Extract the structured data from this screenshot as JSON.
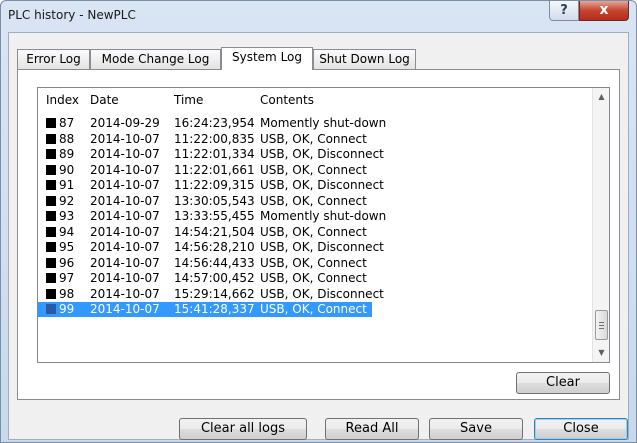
{
  "window": {
    "title": "PLC history - NewPLC",
    "help_label": "?",
    "close_label": "x"
  },
  "tabs": [
    {
      "label": "Error Log"
    },
    {
      "label": "Mode Change Log"
    },
    {
      "label": "System Log",
      "active": true
    },
    {
      "label": "Shut Down Log"
    }
  ],
  "list": {
    "columns": [
      "Index",
      "Date",
      "Time",
      "Contents"
    ],
    "rows": [
      {
        "index": "87",
        "date": "2014-09-29",
        "time": "16:24:23,954",
        "contents": "Momently shut-down"
      },
      {
        "index": "88",
        "date": "2014-10-07",
        "time": "11:22:00,835",
        "contents": "USB, OK, Connect"
      },
      {
        "index": "89",
        "date": "2014-10-07",
        "time": "11:22:01,334",
        "contents": "USB, OK, Disconnect"
      },
      {
        "index": "90",
        "date": "2014-10-07",
        "time": "11:22:01,661",
        "contents": "USB, OK, Connect"
      },
      {
        "index": "91",
        "date": "2014-10-07",
        "time": "11:22:09,315",
        "contents": "USB, OK, Disconnect"
      },
      {
        "index": "92",
        "date": "2014-10-07",
        "time": "13:30:05,543",
        "contents": "USB, OK, Connect"
      },
      {
        "index": "93",
        "date": "2014-10-07",
        "time": "13:33:55,455",
        "contents": "Momently shut-down"
      },
      {
        "index": "94",
        "date": "2014-10-07",
        "time": "14:54:21,504",
        "contents": "USB, OK, Connect"
      },
      {
        "index": "95",
        "date": "2014-10-07",
        "time": "14:56:28,210",
        "contents": "USB, OK, Disconnect"
      },
      {
        "index": "96",
        "date": "2014-10-07",
        "time": "14:56:44,433",
        "contents": "USB, OK, Connect"
      },
      {
        "index": "97",
        "date": "2014-10-07",
        "time": "14:57:00,452",
        "contents": "USB, OK, Connect"
      },
      {
        "index": "98",
        "date": "2014-10-07",
        "time": "15:29:14,662",
        "contents": "USB, OK, Disconnect"
      },
      {
        "index": "99",
        "date": "2014-10-07",
        "time": "15:41:28,337",
        "contents": "USB, OK, Connect",
        "selected": true
      }
    ],
    "selection_color": "#3399ff"
  },
  "buttons": {
    "clear": "Clear",
    "clear_all_logs": "Clear all logs",
    "read_all": "Read All",
    "save": "Save",
    "close": "Close"
  }
}
